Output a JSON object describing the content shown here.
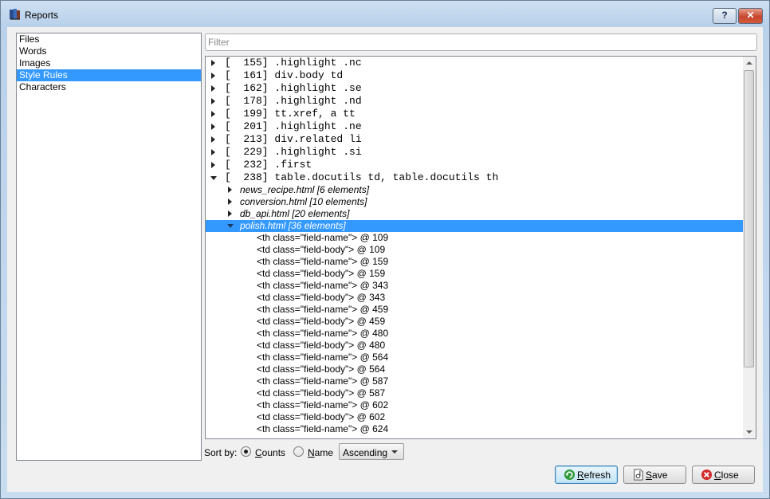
{
  "window": {
    "title": "Reports",
    "help_label": "?",
    "close_label": "✕"
  },
  "sidebar": {
    "items": [
      {
        "label": "Files"
      },
      {
        "label": "Words"
      },
      {
        "label": "Images"
      },
      {
        "label": "Style Rules",
        "selected": true
      },
      {
        "label": "Characters"
      }
    ]
  },
  "filter": {
    "placeholder": "Filter"
  },
  "rules": [
    {
      "count": "155",
      "selector": ".highlight .nc",
      "text": "[  155] .highlight .nc"
    },
    {
      "count": "161",
      "selector": "div.body td",
      "text": "[  161] div.body td"
    },
    {
      "count": "162",
      "selector": ".highlight .se",
      "text": "[  162] .highlight .se"
    },
    {
      "count": "178",
      "selector": ".highlight .nd",
      "text": "[  178] .highlight .nd"
    },
    {
      "count": "199",
      "selector": "tt.xref, a tt",
      "text": "[  199] tt.xref, a tt"
    },
    {
      "count": "201",
      "selector": ".highlight .ne",
      "text": "[  201] .highlight .ne"
    },
    {
      "count": "213",
      "selector": "div.related li",
      "text": "[  213] div.related li"
    },
    {
      "count": "229",
      "selector": ".highlight .si",
      "text": "[  229] .highlight .si"
    },
    {
      "count": "232",
      "selector": ".first",
      "text": "[  232] .first"
    },
    {
      "count": "238",
      "selector": "table.docutils td, table.docutils th",
      "text": "[  238] table.docutils td, table.docutils th",
      "expanded": true
    }
  ],
  "files": [
    {
      "label": "news_recipe.html [6 elements]"
    },
    {
      "label": "conversion.html [10 elements]"
    },
    {
      "label": "db_api.html [20 elements]"
    },
    {
      "label": "polish.html [36 elements]",
      "expanded": true,
      "selected": true
    }
  ],
  "elements": [
    "<th class=\"field-name\"> @ 109",
    "<td class=\"field-body\"> @ 109",
    "<th class=\"field-name\"> @ 159",
    "<td class=\"field-body\"> @ 159",
    "<th class=\"field-name\"> @ 343",
    "<td class=\"field-body\"> @ 343",
    "<th class=\"field-name\"> @ 459",
    "<td class=\"field-body\"> @ 459",
    "<th class=\"field-name\"> @ 480",
    "<td class=\"field-body\"> @ 480",
    "<th class=\"field-name\"> @ 564",
    "<td class=\"field-body\"> @ 564",
    "<th class=\"field-name\"> @ 587",
    "<td class=\"field-body\"> @ 587",
    "<th class=\"field-name\"> @ 602",
    "<td class=\"field-body\"> @ 602",
    "<th class=\"field-name\"> @ 624"
  ],
  "sort": {
    "label": "Sort by:",
    "counts_label": "Counts",
    "name_label": "Name",
    "selected": "Counts",
    "order_value": "Ascending"
  },
  "buttons": {
    "refresh": {
      "label": "Refresh",
      "accel": "R",
      "rest": "efresh"
    },
    "save": {
      "label": "Save",
      "accel": "S",
      "rest": "ave"
    },
    "close": {
      "label": "Close",
      "accel": "C",
      "rest": "lose"
    }
  },
  "colors": {
    "selection": "#3399ff",
    "title_gradient_top": "#cfe0f2",
    "close_button": "#c7462e"
  }
}
